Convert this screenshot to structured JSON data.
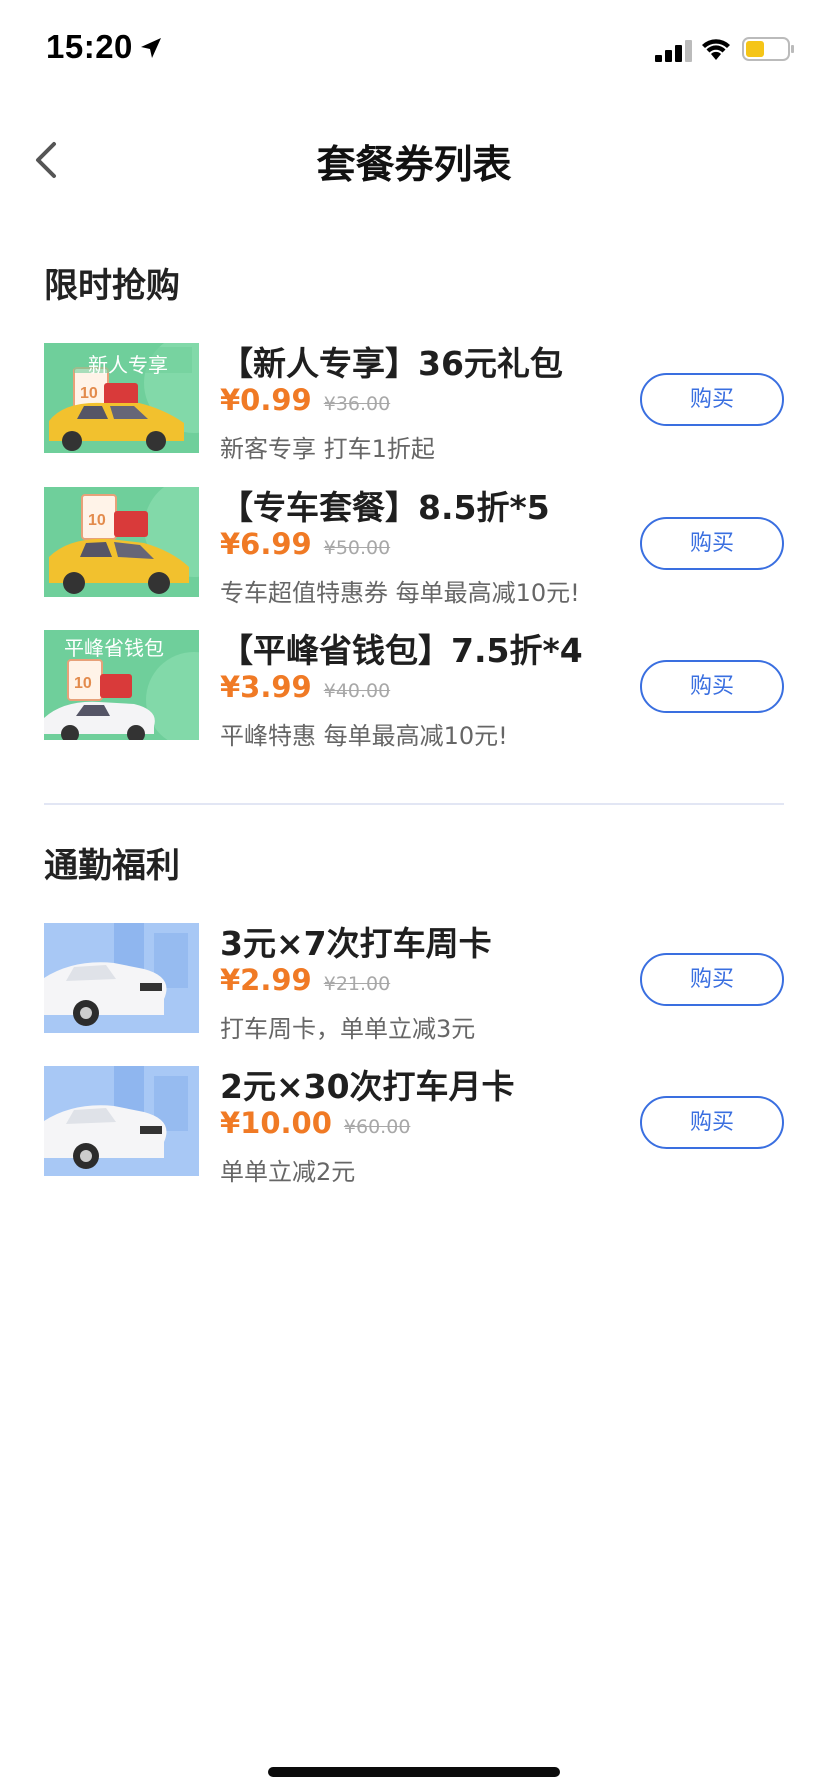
{
  "status_bar": {
    "time": "15:20",
    "icons": [
      "location-arrow-icon",
      "cellular-signal-icon",
      "wifi-icon",
      "battery-icon"
    ],
    "battery_color": "#f5c518"
  },
  "nav": {
    "title": "套餐券列表",
    "back_icon": "chevron-left-icon"
  },
  "colors": {
    "price": "#f07a25",
    "button_accent": "#3a6fe0",
    "divider": "#e2e6f4"
  },
  "sections": [
    {
      "title": "限时抢购",
      "items": [
        {
          "title": "【新人专享】36元礼包",
          "price": "¥0.99",
          "original_price": "¥36.00",
          "description": "新客专享 打车1折起",
          "button": "购买",
          "thumb_label": "新人专享"
        },
        {
          "title": "【专车套餐】8.5折*5",
          "price": "¥6.99",
          "original_price": "¥50.00",
          "description": "专车超值特惠券 每单最高减10元!",
          "button": "购买",
          "thumb_label": ""
        },
        {
          "title": "【平峰省钱包】7.5折*4",
          "price": "¥3.99",
          "original_price": "¥40.00",
          "description": "平峰特惠 每单最高减10元!",
          "button": "购买",
          "thumb_label": "平峰省钱包"
        }
      ]
    },
    {
      "title": "通勤福利",
      "items": [
        {
          "title": "3元×7次打车周卡",
          "price": "¥2.99",
          "original_price": "¥21.00",
          "description": "打车周卡，单单立减3元",
          "button": "购买"
        },
        {
          "title": "2元×30次打车月卡",
          "price": "¥10.00",
          "original_price": "¥60.00",
          "description": "单单立减2元",
          "button": "购买"
        }
      ]
    }
  ]
}
